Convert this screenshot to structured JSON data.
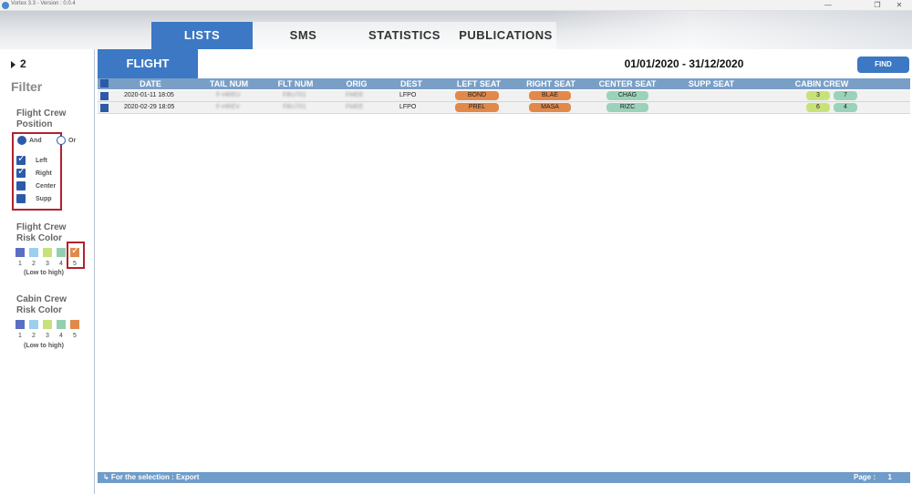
{
  "window": {
    "title": "Vortex 3.3 - Version : 0.0.4",
    "minimize": "—",
    "maximize": "❐",
    "close": "✕"
  },
  "tabs": [
    {
      "label": "LISTS",
      "active": true
    },
    {
      "label": "SMS",
      "active": false
    },
    {
      "label": "STATISTICS",
      "active": false
    },
    {
      "label": "PUBLICATIONS",
      "active": false
    }
  ],
  "left_panel": {
    "count": "2",
    "filter_title": "Filter",
    "crew_position": {
      "title_line1": "Flight Crew",
      "title_line2": "Position",
      "and_label": "And",
      "or_label": "Or",
      "options": [
        {
          "label": "Left",
          "checked": true
        },
        {
          "label": "Right",
          "checked": true
        },
        {
          "label": "Center",
          "checked": false
        },
        {
          "label": "Supp",
          "checked": false
        }
      ]
    },
    "flight_risk": {
      "title_line1": "Flight Crew",
      "title_line2": "Risk Color",
      "swatches": [
        {
          "num": "1",
          "color": "#5b6fc2",
          "checked": false
        },
        {
          "num": "2",
          "color": "#9ccfee",
          "checked": false
        },
        {
          "num": "3",
          "color": "#c6e27a",
          "checked": false
        },
        {
          "num": "4",
          "color": "#93d0b2",
          "checked": false
        },
        {
          "num": "5",
          "color": "#e08a4b",
          "checked": true
        }
      ],
      "scale": "(Low to high)"
    },
    "cabin_risk": {
      "title_line1": "Cabin Crew",
      "title_line2": "Risk Color",
      "swatches": [
        {
          "num": "1",
          "color": "#5b6fc2"
        },
        {
          "num": "2",
          "color": "#9ccfee"
        },
        {
          "num": "3",
          "color": "#c6e27a"
        },
        {
          "num": "4",
          "color": "#93d0b2"
        },
        {
          "num": "5",
          "color": "#e08a4b"
        }
      ],
      "scale": "(Low to high)"
    }
  },
  "main": {
    "flight_tab": "FLIGHT",
    "date_range": "01/01/2020 - 31/12/2020",
    "find_label": "FIND",
    "columns": [
      "DATE",
      "TAIL NUM",
      "FLT NUM",
      "ORIG",
      "DEST",
      "LEFT SEAT",
      "RIGHT SEAT",
      "CENTER SEAT",
      "SUPP SEAT",
      "CABIN CREW"
    ],
    "rows": [
      {
        "date": "2020-01-11 18:05",
        "tail": "F-HREU",
        "flt": "FBU701",
        "orig": "FMEE",
        "dest": "LFPO",
        "left": "BOND",
        "right": "BLAE",
        "center": "CHAG",
        "cabin_a": "3",
        "cabin_b": "7"
      },
      {
        "date": "2020-02-29 18:05",
        "tail": "F-HREV",
        "flt": "FBU701",
        "orig": "FMEE",
        "dest": "LFPO",
        "left": "PREL",
        "right": "MASA",
        "center": "RIZC",
        "cabin_a": "6",
        "cabin_b": "4"
      }
    ]
  },
  "footer": {
    "selection_label": "↳ For the selection :  Export",
    "page_label": "Page :",
    "page_number": "1"
  }
}
